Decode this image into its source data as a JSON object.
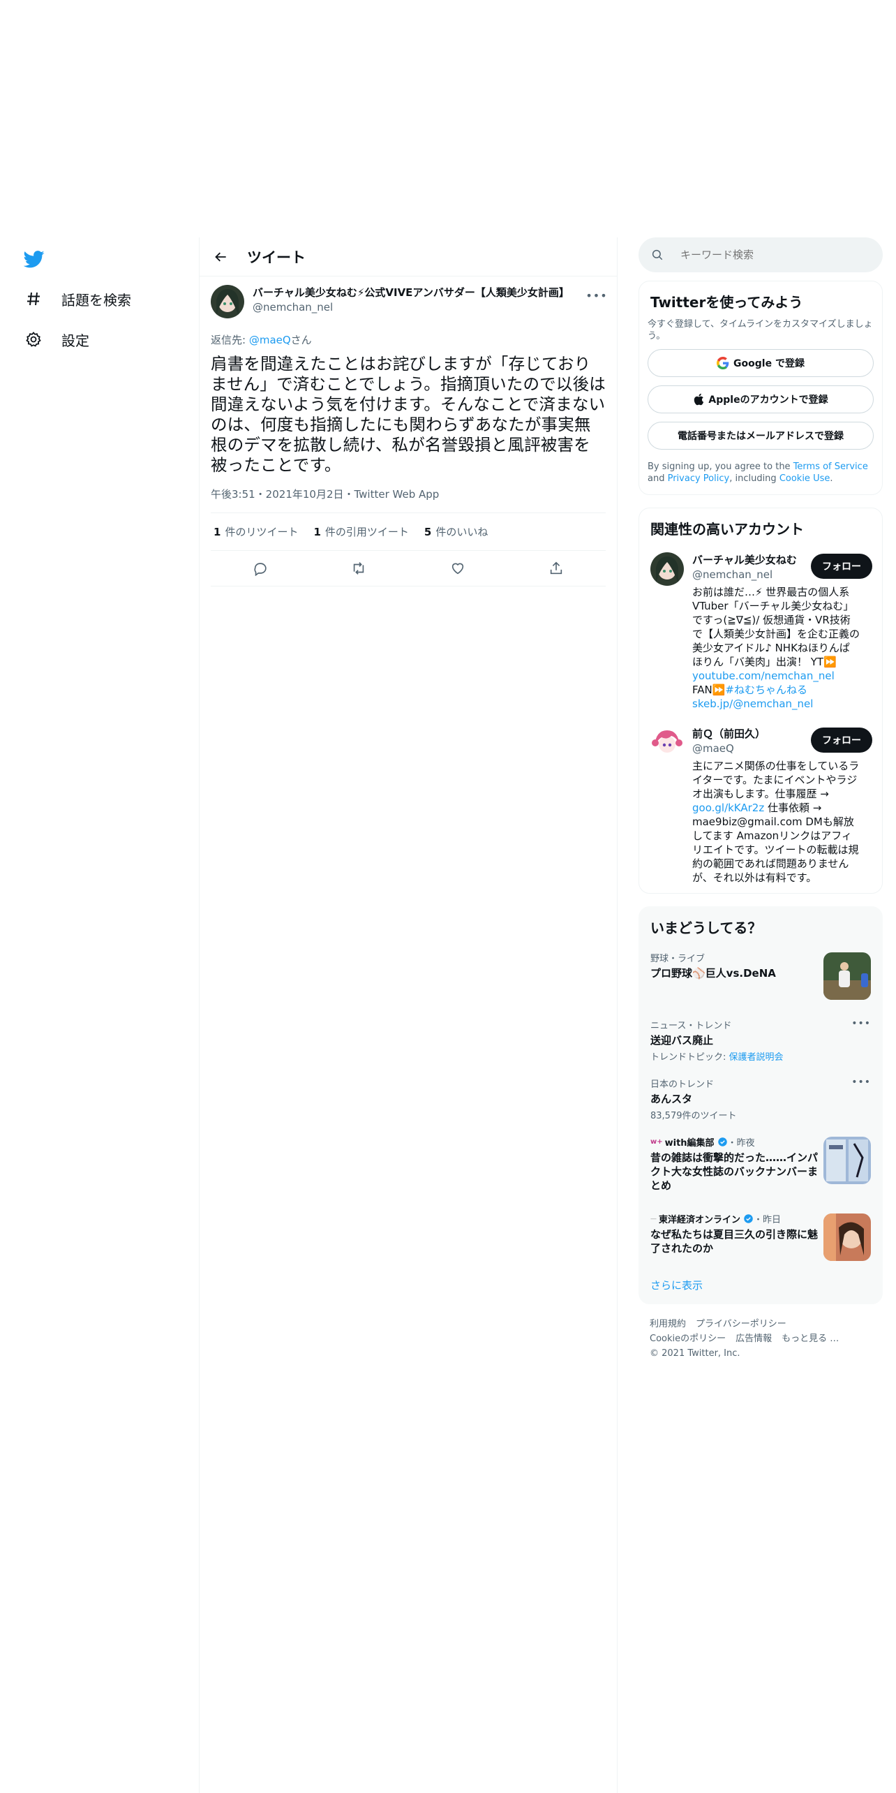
{
  "nav": {
    "explore_label": "話題を検索",
    "settings_label": "設定"
  },
  "header": {
    "title": "ツイート"
  },
  "tweet": {
    "author_name": "バーチャル美少女ねむ⚡公式VIVEアンバサダー【人類美少女計画】",
    "author_handle": "@nemchan_nel",
    "reply_prefix": "返信先: ",
    "reply_user": "@maeQ",
    "reply_suffix": "さん",
    "text": "肩書を間違えたことはお詫びしますが「存じておりません」で済むことでしょう。指摘頂いたので以後は間違えないよう気を付けます。そんなことで済まないのは、何度も指摘したにも関わらずあなたが事実無根のデマを拡散し続け、私が名誉毀損と風評被害を被ったことです。",
    "meta": "午後3:51・2021年10月2日・Twitter Web App",
    "retweets_count": "1",
    "retweets_label": "件のリツイート",
    "quotes_count": "1",
    "quotes_label": "件の引用ツイート",
    "likes_count": "5",
    "likes_label": "件のいいね"
  },
  "search": {
    "placeholder": "キーワード検索"
  },
  "signup": {
    "title": "Twitterを使ってみよう",
    "subtitle": "今すぐ登録して、タイムラインをカスタマイズしましょう。",
    "google_label": "Google で登録",
    "apple_label": "Appleのアカウントで登録",
    "phone_label": "電話番号またはメールアドレスで登録",
    "terms_prefix": "By signing up, you agree to the ",
    "terms_link": "Terms of Service",
    "terms_and": " and ",
    "privacy_link": "Privacy Policy",
    "terms_including": ", including ",
    "cookie_link": "Cookie Use",
    "terms_end": "."
  },
  "related": {
    "title": "関連性の高いアカウント",
    "follow_label": "フォロー",
    "accounts": [
      {
        "name": "バーチャル美少女ねむ",
        "handle": "@nemchan_nel",
        "bio": "お前は誰だ…⚡ 世界最古の個人系VTuber「バーチャル美少女ねむ」ですっ(≧∇≦)/ 仮想通貨・VR技術で【人類美少女計画】を企む正義の美少女アイドル♪ NHKねほりんぱほりん「バ美肉」出演！ YT⏩",
        "link1": "youtube.com/nemchan_nel",
        "mid": " FAN⏩",
        "tag": "#ねむちゃんねる",
        "link2": "skeb.jp/@nemchan_nel"
      },
      {
        "name": "前Ｑ（前田久）",
        "handle": "@maeQ",
        "bio_a": "主にアニメ関係の仕事をしているライターです。たまにイベントやラジオ出演もします。仕事履歴 → ",
        "link1": "goo.gl/kKAr2z",
        "bio_b": " 仕事依頼 → mae9biz@gmail.com DMも解放してます Amazonリンクはアフィリエイトです。ツイートの転載は規約の範囲であれば問題ありませんが、それ以外は有料です。"
      }
    ]
  },
  "trends": {
    "title": "いまどうしてる？",
    "items": [
      {
        "category": "野球・ライブ",
        "name": "プロ野球⚾巨人vs.DeNA"
      },
      {
        "category": "ニュース・トレンド",
        "name": "送迎バス廃止",
        "sub_prefix": "トレンドトピック: ",
        "sub_link": "保護者説明会"
      },
      {
        "category": "日本のトレンド",
        "name": "あんスタ",
        "sub": "83,579件のツイート"
      },
      {
        "source": "with編集部",
        "time": "・昨夜",
        "name": "昔の雑誌は衝撃的だった……インパクト大な女性誌のバックナンバーまとめ"
      },
      {
        "source": "東洋経済オンライン",
        "time": "・昨日",
        "name": "なぜ私たちは夏目三久の引き際に魅了されたのか"
      }
    ],
    "show_more": "さらに表示"
  },
  "footer": {
    "links_row1": [
      "利用規約",
      "プライバシーポリシー"
    ],
    "links_row2": [
      "Cookieのポリシー",
      "広告情報",
      "もっと見る …"
    ],
    "copyright": "© 2021 Twitter, Inc."
  },
  "colors": {
    "accent": "#1d9bf0",
    "text": "#0f1419",
    "muted": "#536471",
    "border": "#eff3f4"
  }
}
